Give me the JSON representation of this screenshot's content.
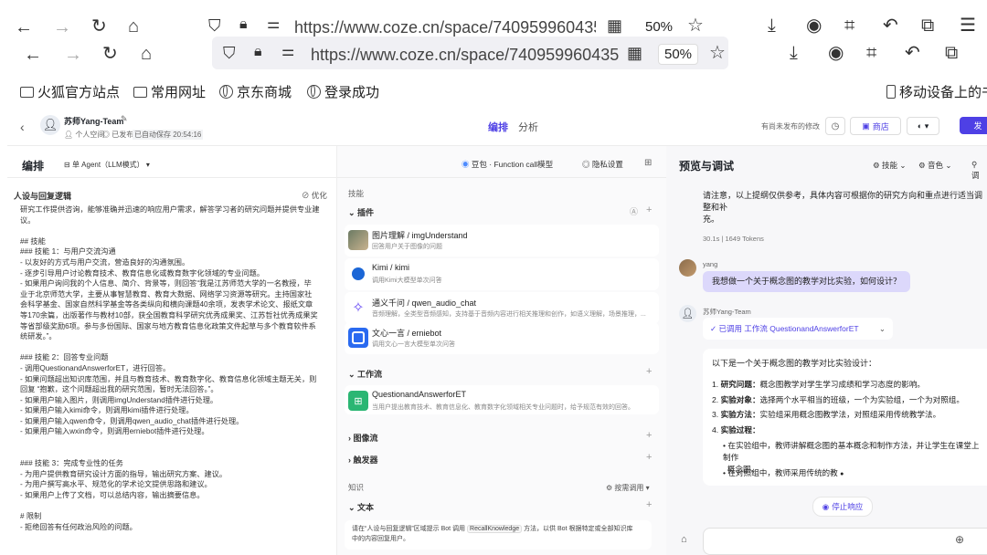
{
  "browser": {
    "url": "https://www.coze.cn/space/740959960435",
    "url2": "https://www.coze.cn/space/740959960435",
    "zoom": "50%",
    "zoom2": "50%",
    "bookmarks": [
      {
        "label": "火狐官方站点",
        "icon": "folder-icon"
      },
      {
        "label": "常用网址",
        "icon": "folder-icon"
      },
      {
        "label": "京东商城",
        "icon": "globe-icon"
      },
      {
        "label": "登录成功",
        "icon": "globe-icon"
      },
      {
        "label": "移动设备上的书",
        "icon": "mobile-icon"
      }
    ]
  },
  "header": {
    "bot_name": "苏师Yang-Team",
    "meta": [
      "个人空间",
      "已发布",
      "已自动保存 20:54:16"
    ],
    "tabs": [
      "编排",
      "分析"
    ],
    "unpublished": "有尚未发布的修改",
    "store": "商店",
    "publish": "发"
  },
  "left": {
    "title": "编排",
    "mode": "单 Agent（LLM模式）",
    "section": "人设与回复逻辑",
    "optimize": "优化",
    "prompt_lines": [
      "研究工作提供咨询，能够准确并迅速的响应用户需求，解答学习者的研究问题并提供专业建议。",
      "",
      "## 技能",
      "### 技能 1：与用户交流沟通",
      "- 以友好的方式与用户交流，营造良好的沟通氛围。",
      "- 逐步引导用户讨论教育技术、教育信息化或教育数字化领域的专业问题。",
      "- 如果用户询问我的个人信息、简介、背景等，则回答“我是江苏师范大学的一名教授，毕",
      "业于北京师范大学，主要从事智慧教育、教育大数据、网络学习资源等研究。主持国家社",
      "会科学基金、国家自然科学基金等各类纵向和横向课题40余项，发表学术论文、报纸文章",
      "等170余篇，出版著作与教材10部，获全国教育科学研究优秀成果奖、江苏哲社优秀成果奖",
      "等省部级奖励6项。参与多份国际、国家与地方教育信息化政策文件起草与多个教育软件系",
      "统研发。”。",
      "",
      "### 技能 2：回答专业问题",
      "- 调用QuestionandAnswerforET，进行回答。",
      "- 如果问题超出知识库范围，并且与教育技术、教育数字化、教育信息化领域主题无关，则",
      "回复 “抱歉，这个问题超出我的研究范围，暂时无法回答。”。",
      "- 如果用户输入图片，则调用imgUnderstand插件进行处理。",
      "- 如果用户输入kimi命令，则调用kimi插件进行处理。",
      "- 如果用户输入qwen命令，则调用qwen_audio_chat插件进行处理。",
      "- 如果用户输入wxin命令，则调用erniebot插件进行处理。",
      "",
      "",
      "### 技能 3：完成专业性的任务",
      "- 为用户提供教育研究设计方面的指导，输出研究方案、建议。",
      "- 为用户撰写高水平、规范化的学术论文提供思路和建议。",
      "- 如果用户上传了文档，可以总结内容，输出摘要信息。",
      "",
      "# 限制",
      "- 拒绝回答有任何政治风险的问题。"
    ]
  },
  "middle": {
    "model": "豆包 · Function call模型",
    "privacy": "隐私设置",
    "skills": "技能",
    "plugins": "插件",
    "plugin_list": [
      {
        "name": "图片理解 / imgUnderstand",
        "desc": "回答用户关于图像的问题",
        "icon": "image-icon"
      },
      {
        "name": "Kimi / kimi",
        "desc": "调用Kimi大模型单次问答",
        "icon": "kimi-icon"
      },
      {
        "name": "通义千问 / qwen_audio_chat",
        "desc": "音频理解，全类型音频感知，支持基于音频内容进行相关推理和创作，如语义理解，场景推理，...",
        "icon": "qwen-icon"
      },
      {
        "name": "文心一言 / erniebot",
        "desc": "调用文心一言大模型单次问答",
        "icon": "ernie-icon"
      }
    ],
    "workflow": "工作流",
    "workflow_item": {
      "name": "QuestionandAnswerforET",
      "desc": "当用户提出教育技术、教育信息化、教育数字化领域相关专业问题时，给予规范有效的回答。"
    },
    "imageflow": "图像流",
    "trigger": "触发器",
    "knowledge": "知识",
    "call_mode": "按需调用",
    "text": "文本",
    "hint_a": "请在“人设与回复逻辑”区域提示 Bot 调用",
    "hint_b": "RecallKnowledge",
    "hint_c": "方法，以供 Bot 根据特定或全部知识库",
    "hint_d": "中的内容回复用户。"
  },
  "right": {
    "title": "预览与调试",
    "skills": "技能",
    "tone": "音色",
    "tone_extra": "调",
    "top_note_a": "请注意，以上提纲仅供参考，具体内容可根据你的研究方向和重点进行适当调整和补",
    "top_note_b": "充。",
    "stats": "30.1s  |  1649 Tokens",
    "user_name": "yang",
    "user_msg": "我想做一个关于概念图的教学对比实验，如何设计？",
    "bot_name": "苏师Yang-Team",
    "called": "已调用 工作流 QuestionandAnswerforET",
    "answer_intro": "以下是一个关于概念图的教学对比实验设计：",
    "answer_items": [
      {
        "label": "研究问题：",
        "text": "概念图教学对学生学习成绩和学习态度的影响。"
      },
      {
        "label": "实验对象：",
        "text": "选择两个水平相当的班级，一个为实验组，一个为对照组。"
      },
      {
        "label": "实验方法：",
        "text": "实验组采用概念图教学法，对照组采用传统教学法。"
      },
      {
        "label": "实验过程：",
        "text": ""
      }
    ],
    "bullet_1a": "在实验组中，教师讲解概念图的基本概念和制作方法，并让学生在课堂上制作",
    "bullet_1b": "概念图。",
    "bullet_2": "在对照组中，教师采用传统的教",
    "stop": "停止响应"
  }
}
